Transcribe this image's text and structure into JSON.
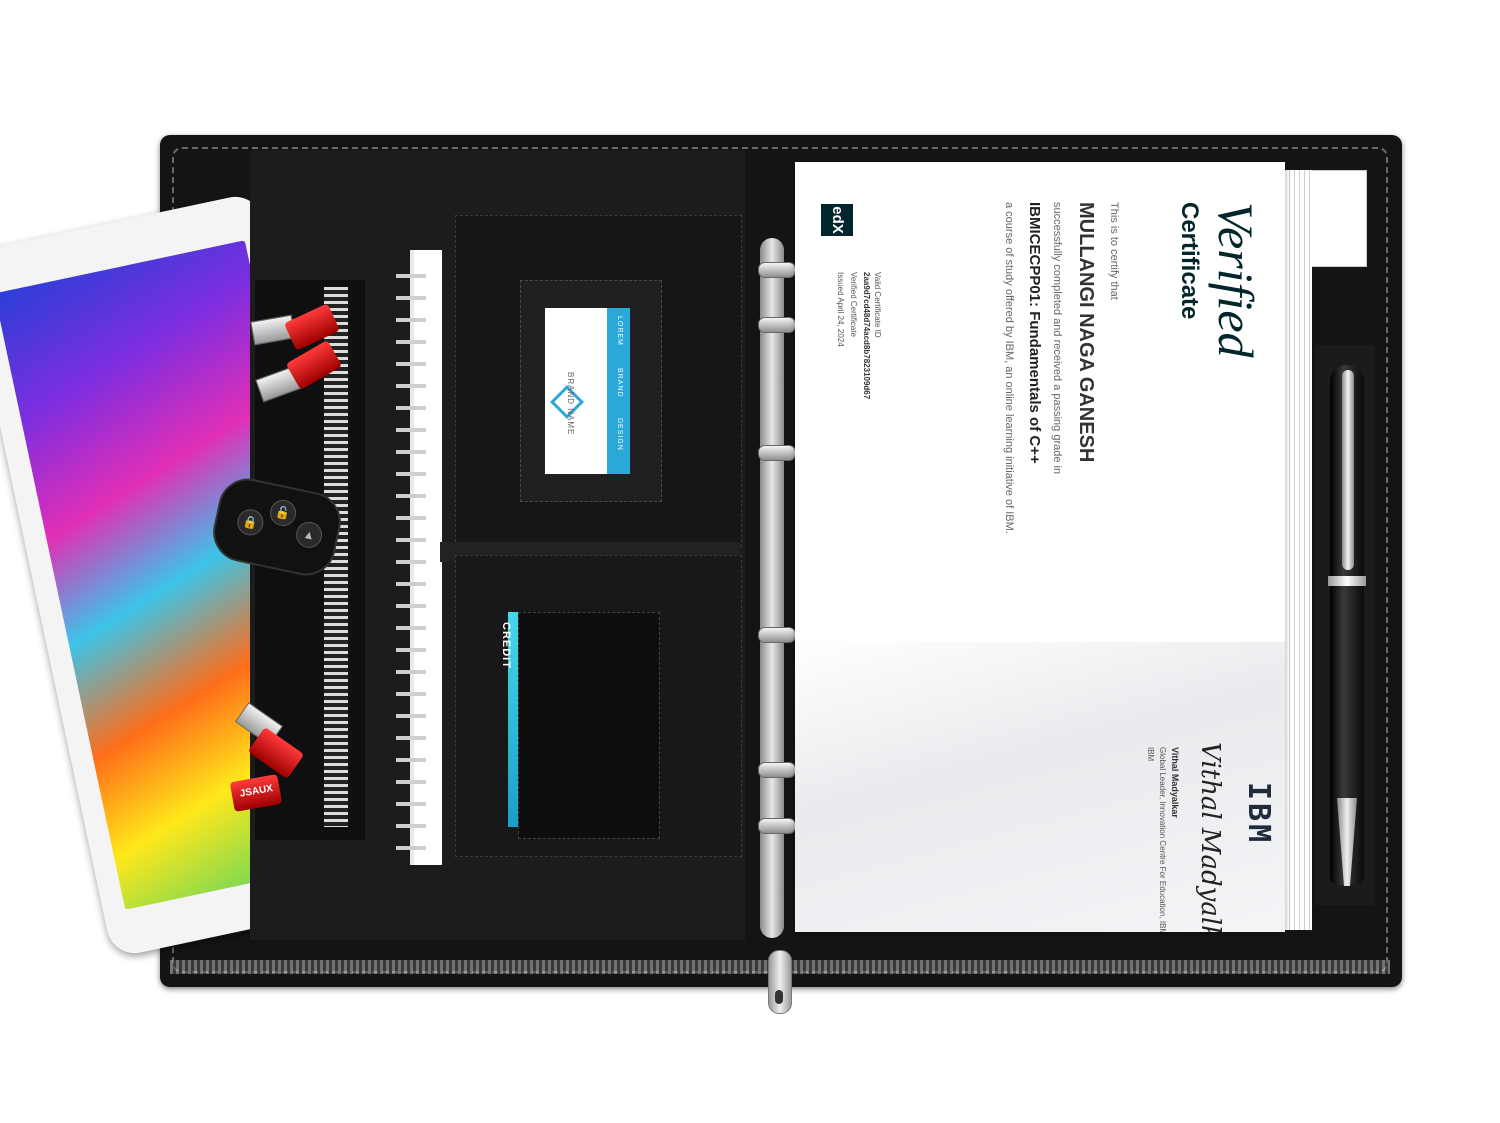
{
  "business_card": {
    "brand": "BRAND NAME",
    "strip_items": [
      "DESIGN",
      "BRAND",
      "LOREM"
    ]
  },
  "credit_card": {
    "label": "CREDIT"
  },
  "usb_cable": {
    "brand": "JSAUX"
  },
  "certificate": {
    "logo": "edX",
    "heading_word1": "Verified",
    "heading_word2": "Certificate",
    "line1": "This is to certify that",
    "recipient": "MULLANGI NAGA GANESH",
    "line2": "successfully completed and received a passing grade in",
    "course": "IBMICECPP01: Fundamentals of C++",
    "line3": "a course of study offered by IBM, an online learning initiative of IBM.",
    "cert_type": "Verified Certificate",
    "issued": "Issued April 24, 2024",
    "id_label": "Valid Certificate ID",
    "id_value": "2aa9d7cd48d74acd8b7823109d67",
    "signature": "Vithal Madyalkar",
    "signer_name": "Vithal Madyalkar",
    "signer_title": "Global Leader, Innovation Centre For Education, IBM",
    "signer_org": "IBM",
    "issuer_logo": "IBM"
  },
  "colors": {
    "portfolio": "#141414",
    "accent_blue": "#2aa8d8",
    "cert_dark": "#02262b"
  }
}
